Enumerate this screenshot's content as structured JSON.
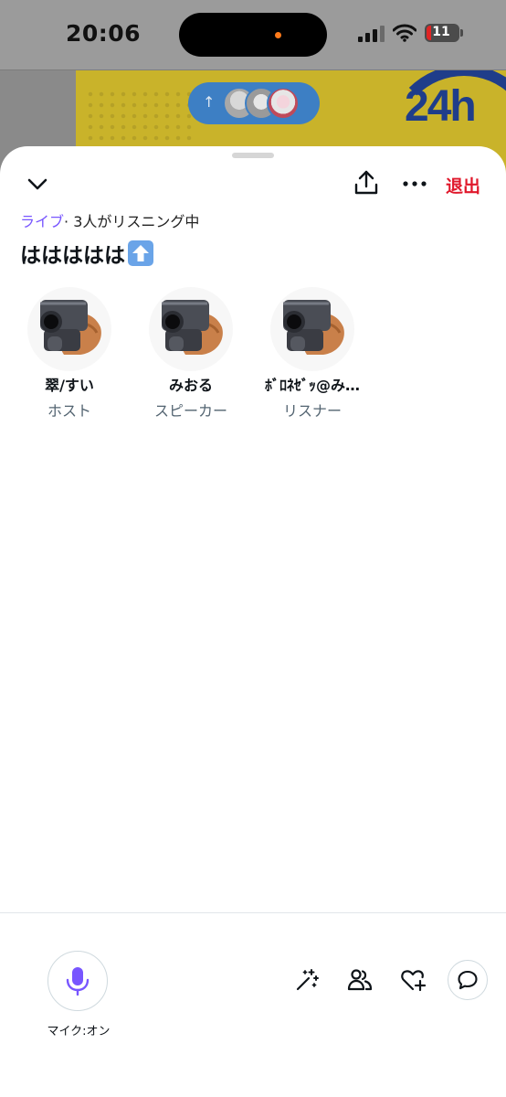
{
  "status_bar": {
    "time": "20:06",
    "battery": "11"
  },
  "background": {
    "banner_text": "24h"
  },
  "header": {
    "leave_label": "退出"
  },
  "space": {
    "live_label": "ライブ",
    "listening_text": "· 3人がリスニング中",
    "title": "ははははは"
  },
  "participants": [
    {
      "name": "翠/すい",
      "role": "ホスト"
    },
    {
      "name": "みおる",
      "role": "スピーカー"
    },
    {
      "name": "ﾎﾞﾛﾈｾﾞｯ@み…",
      "role": "リスナー"
    }
  ],
  "footer": {
    "mic_label": "マイク:オン"
  },
  "colors": {
    "accent": "#7856ff",
    "leave": "#e0182b",
    "role_text": "#536471"
  },
  "icons": [
    "chevron-down-icon",
    "share-icon",
    "more-icon",
    "microphone-icon",
    "magic-wand-icon",
    "people-icon",
    "heart-plus-icon",
    "comment-icon",
    "pistol-hand-image"
  ]
}
